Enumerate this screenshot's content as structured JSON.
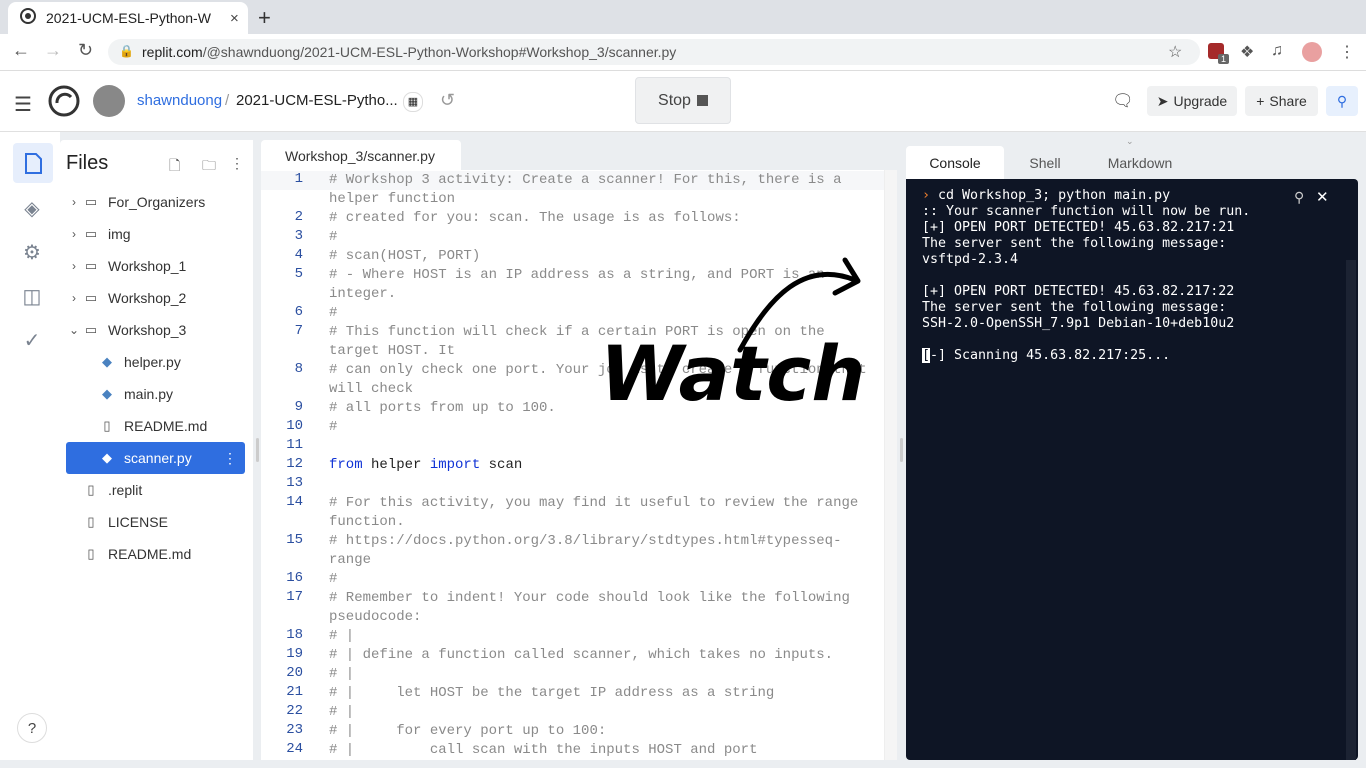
{
  "browser": {
    "tab_title": "2021-UCM-ESL-Python-W",
    "tab_close": "×",
    "new_tab": "+",
    "url_host": "replit.com",
    "url_path": "/@shawnduong/2021-UCM-ESL-Python-Workshop#Workshop_3/scanner.py",
    "ext_badge": "1"
  },
  "header": {
    "username": "shawnduong",
    "separator": "/",
    "repl_name": "2021-UCM-ESL-Pytho...",
    "stop_label": "Stop",
    "upgrade_label": "Upgrade",
    "share_label": "Share"
  },
  "files": {
    "title": "Files",
    "items": [
      {
        "label": "For_Organizers",
        "type": "folder",
        "expanded": false
      },
      {
        "label": "img",
        "type": "folder",
        "expanded": false
      },
      {
        "label": "Workshop_1",
        "type": "folder",
        "expanded": false
      },
      {
        "label": "Workshop_2",
        "type": "folder",
        "expanded": false
      },
      {
        "label": "Workshop_3",
        "type": "folder",
        "expanded": true
      },
      {
        "label": "helper.py",
        "type": "python"
      },
      {
        "label": "main.py",
        "type": "python"
      },
      {
        "label": "README.md",
        "type": "file"
      },
      {
        "label": "scanner.py",
        "type": "python",
        "active": true
      },
      {
        "label": ".replit",
        "type": "file"
      },
      {
        "label": "LICENSE",
        "type": "file"
      },
      {
        "label": "README.md",
        "type": "file"
      }
    ]
  },
  "editor": {
    "tab_label": "Workshop_3/scanner.py",
    "lines": [
      {
        "n": "1",
        "text": "# Workshop 3 activity: Create a scanner! For this, there is a helper function"
      },
      {
        "n": "2",
        "text": "# created for you: scan. The usage is as follows:"
      },
      {
        "n": "3",
        "text": "#"
      },
      {
        "n": "4",
        "text": "# scan(HOST, PORT)"
      },
      {
        "n": "5",
        "text": "# - Where HOST is an IP address as a string, and PORT is an integer."
      },
      {
        "n": "6",
        "text": "#"
      },
      {
        "n": "7",
        "text": "# This function will check if a certain PORT is open on the target HOST. It"
      },
      {
        "n": "8",
        "text": "# can only check one port. Your job is to create a function that will check"
      },
      {
        "n": "9",
        "text": "# all ports from up to 100."
      },
      {
        "n": "10",
        "text": "#"
      },
      {
        "n": "11",
        "text": ""
      },
      {
        "n": "12",
        "kw1": "from",
        "mid": " helper ",
        "kw2": "import",
        "end": " scan"
      },
      {
        "n": "13",
        "text": ""
      },
      {
        "n": "14",
        "text": "# For this activity, you may find it useful to review the range function."
      },
      {
        "n": "15",
        "text": "# https://docs.python.org/3.8/library/stdtypes.html#typesseq-range"
      },
      {
        "n": "16",
        "text": "#"
      },
      {
        "n": "17",
        "text": "# Remember to indent! Your code should look like the following pseudocode:"
      },
      {
        "n": "18",
        "text": "# |"
      },
      {
        "n": "19",
        "text": "# | define a function called scanner, which takes no inputs."
      },
      {
        "n": "20",
        "text": "# |"
      },
      {
        "n": "21",
        "text": "# |     let HOST be the target IP address as a string"
      },
      {
        "n": "22",
        "text": "# |"
      },
      {
        "n": "23",
        "text": "# |     for every port up to 100:"
      },
      {
        "n": "24",
        "text": "# |         call scan with the inputs HOST and port"
      }
    ]
  },
  "console": {
    "tabs": [
      "Console",
      "Shell",
      "Markdown"
    ],
    "prompt_glyph": "›",
    "command": " cd Workshop_3; python main.py",
    "lines": [
      ":: Your scanner function will now be run.",
      "[+] OPEN PORT DETECTED! 45.63.82.217:21",
      "The server sent the following message:",
      "vsftpd-2.3.4",
      "",
      "[+] OPEN PORT DETECTED! 45.63.82.217:22",
      "The server sent the following message:",
      "SSH-2.0-OpenSSH_7.9p1 Debian-10+deb10u2",
      ""
    ],
    "cursor_char": "[",
    "last_line": "-] Scanning 45.63.82.217:25..."
  },
  "annotation": {
    "text": "Watch"
  },
  "help": "?"
}
